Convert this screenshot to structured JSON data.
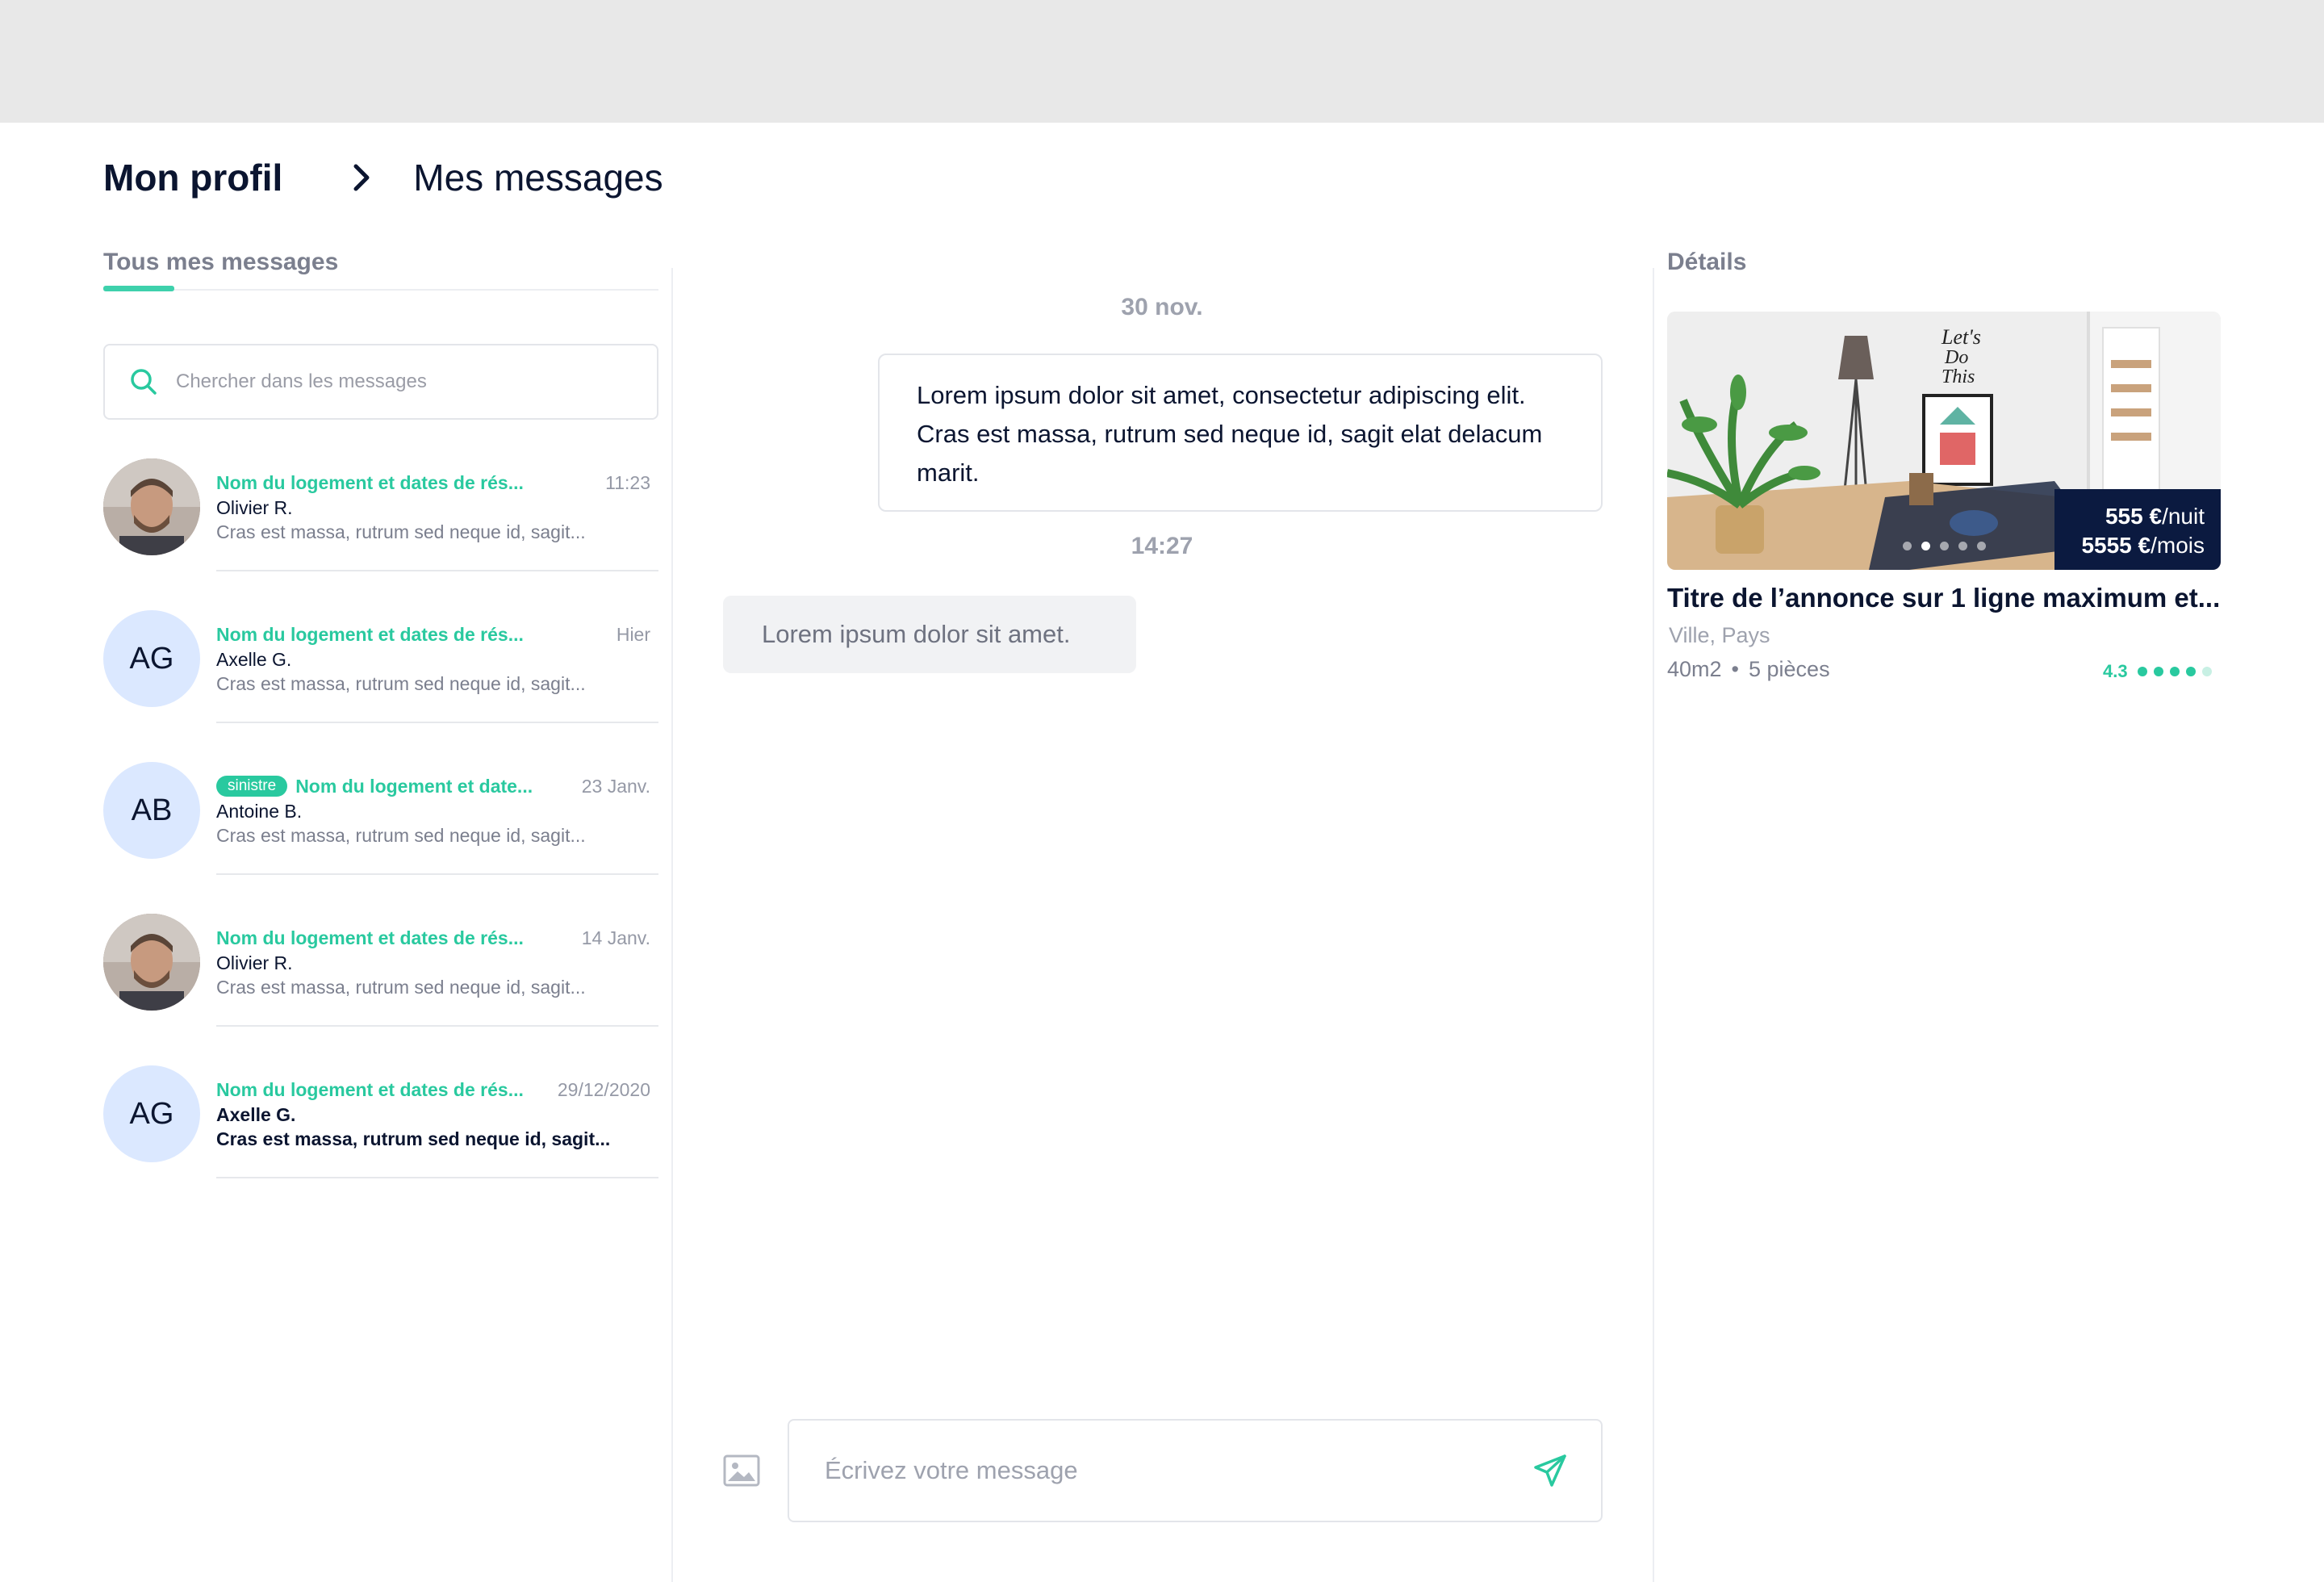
{
  "breadcrumb": {
    "root": "Mon profil",
    "current": "Mes messages"
  },
  "tabs": {
    "all_messages": "Tous mes messages"
  },
  "search": {
    "placeholder": "Chercher dans les messages"
  },
  "conversations": [
    {
      "title": "Nom du logement et dates de rés...",
      "time": "11:23",
      "name": "Olivier R.",
      "preview": "Cras est massa, rutrum sed neque id, sagit...",
      "avatar": "photo"
    },
    {
      "title": "Nom du logement et dates de rés...",
      "time": "Hier",
      "name": "Axelle G.",
      "preview": "Cras est massa, rutrum sed neque id, sagit...",
      "initials": "AG"
    },
    {
      "badge": "sinistre",
      "title": "Nom du logement et date...",
      "time": "23 Janv.",
      "name": "Antoine B.",
      "preview": "Cras est massa, rutrum sed neque id, sagit...",
      "initials": "AB"
    },
    {
      "title": "Nom du logement et dates de rés...",
      "time": "14 Janv.",
      "name": "Olivier R.",
      "preview": "Cras est massa, rutrum sed neque id, sagit...",
      "avatar": "photo"
    },
    {
      "title": "Nom du logement et dates de rés...",
      "time": "29/12/2020",
      "name": "Axelle G.",
      "preview": "Cras est massa, rutrum sed neque id, sagit...",
      "initials": "AG",
      "unread": true
    }
  ],
  "chat": {
    "date": "30 nov.",
    "outgoing_message": "Lorem ipsum dolor sit amet, consectetur adipiscing elit. Cras est massa, rutrum sed neque id, sagit elat delacum marit.",
    "time": "14:27",
    "incoming_message": "Lorem ipsum dolor sit amet.",
    "composer_placeholder": "Écrivez votre message"
  },
  "details": {
    "label": "Détails",
    "price_night": "555 €",
    "price_night_unit": "/nuit",
    "price_month": "5555 €",
    "price_month_unit": "/mois",
    "carousel_slides": 5,
    "carousel_active": 1,
    "title": "Titre de l’annonce sur 1 ligne maximum et...",
    "location": "Ville, Pays",
    "surface": "40m2",
    "separator": "•",
    "rooms": "5 pièces",
    "rating": "4.3",
    "rating_out_of": 5,
    "rating_filled": 4
  },
  "colors": {
    "accent": "#29c99f",
    "navy": "#0b1a40",
    "avatar_bg": "#dbe8ff"
  }
}
